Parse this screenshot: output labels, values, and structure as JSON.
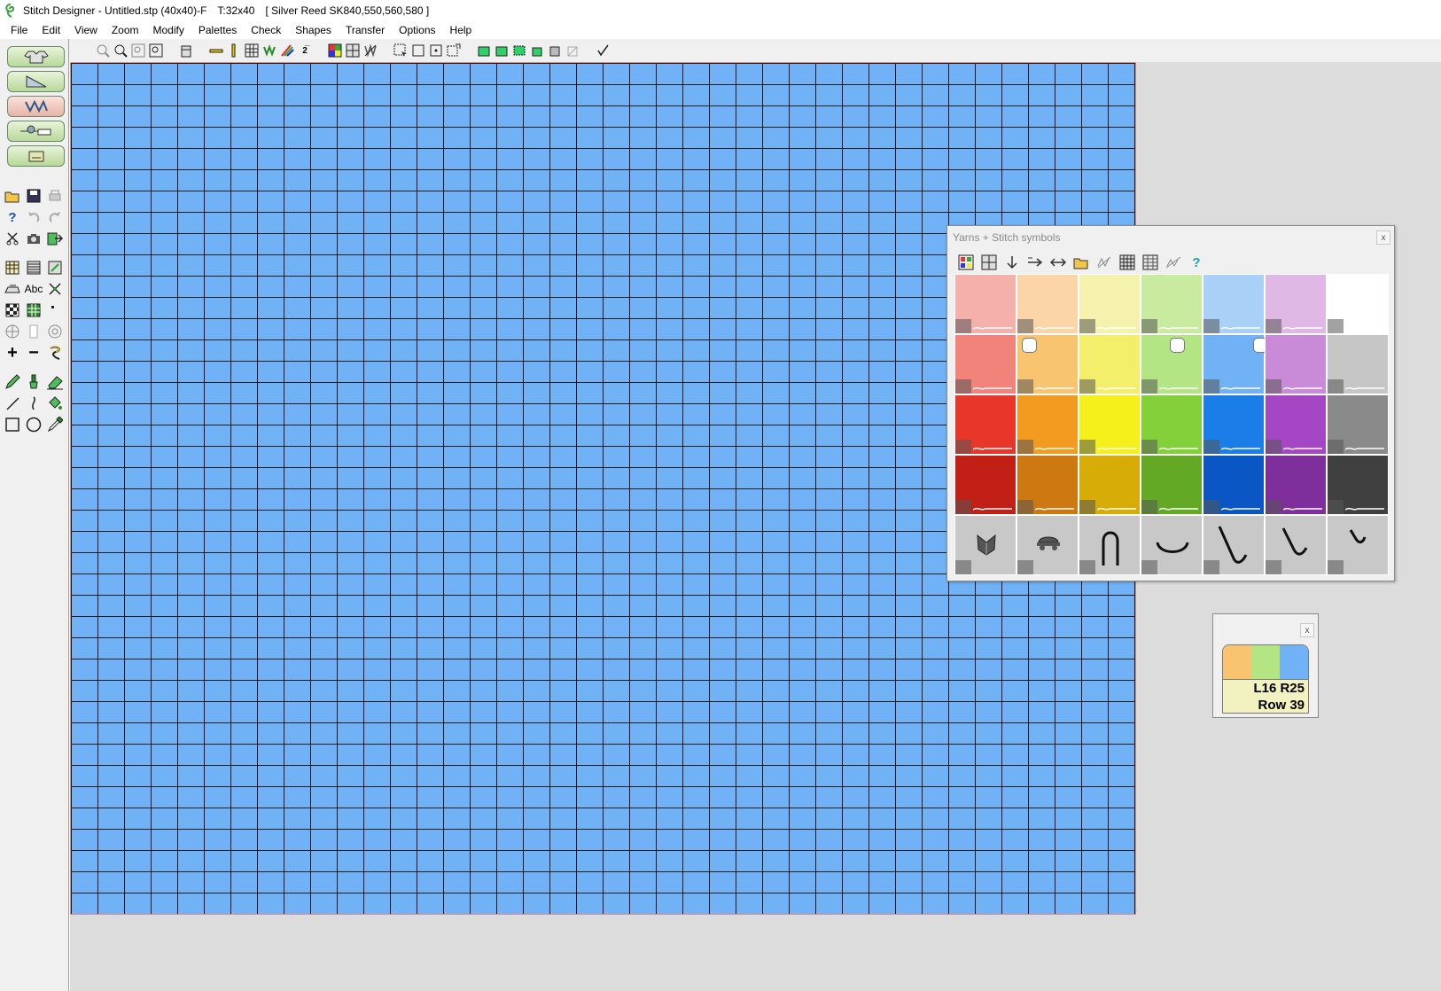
{
  "titlebar": {
    "title": "Stitch Designer - Untitled.stp (40x40)-F",
    "tension": "T:32x40",
    "machine": "[ Silver Reed SK840,550,560,580 ]"
  },
  "menu": [
    "File",
    "Edit",
    "View",
    "Zoom",
    "Modify",
    "Palettes",
    "Check",
    "Shapes",
    "Transfer",
    "Options",
    "Help"
  ],
  "grid": {
    "columns": 40,
    "rows": 40,
    "fill_color": "#71b1f5"
  },
  "palette_window": {
    "title": "Yarns + Stitch symbols",
    "close_label": "x",
    "tool_icons": [
      "grid-view-icon",
      "symbol-view-icon",
      "move-down-icon",
      "move-right-icon",
      "swap-icon",
      "open-folder-icon",
      "clear-icon",
      "color-grid-icon",
      "color-table-icon",
      "disable-icon",
      "help-icon"
    ],
    "help_label": "?",
    "color_rows": [
      [
        "#f6b0ab",
        "#fbd5a8",
        "#f5f2ae",
        "#c8eba0",
        "#a9d1f8",
        "#e0b8e6",
        "#ffffff"
      ],
      [
        "#f2837a",
        "#f8c470",
        "#f3ef6a",
        "#b3e585",
        "#71b1f5",
        "#c98ad8",
        "#c6c6c6"
      ],
      [
        "#e9362b",
        "#f39a20",
        "#f5f01c",
        "#84d03a",
        "#1b7ee8",
        "#a547c4",
        "#8a8a8a"
      ],
      [
        "#c21f17",
        "#cd7810",
        "#d8ac06",
        "#64a925",
        "#0a56c4",
        "#7e2f9b",
        "#404040"
      ]
    ],
    "stitch_symbols": [
      "tuck-stitch-icon",
      "slip-stitch-icon",
      "cable-icon",
      "float-icon",
      "hook-long-icon",
      "hook-medium-icon",
      "hook-short-icon"
    ]
  },
  "status_widget": {
    "close_label": "x",
    "yarn_colors": [
      "#f8c470",
      "#b3e585",
      "#71b1f5"
    ],
    "position": "L16 R25",
    "row": "Row 39"
  }
}
